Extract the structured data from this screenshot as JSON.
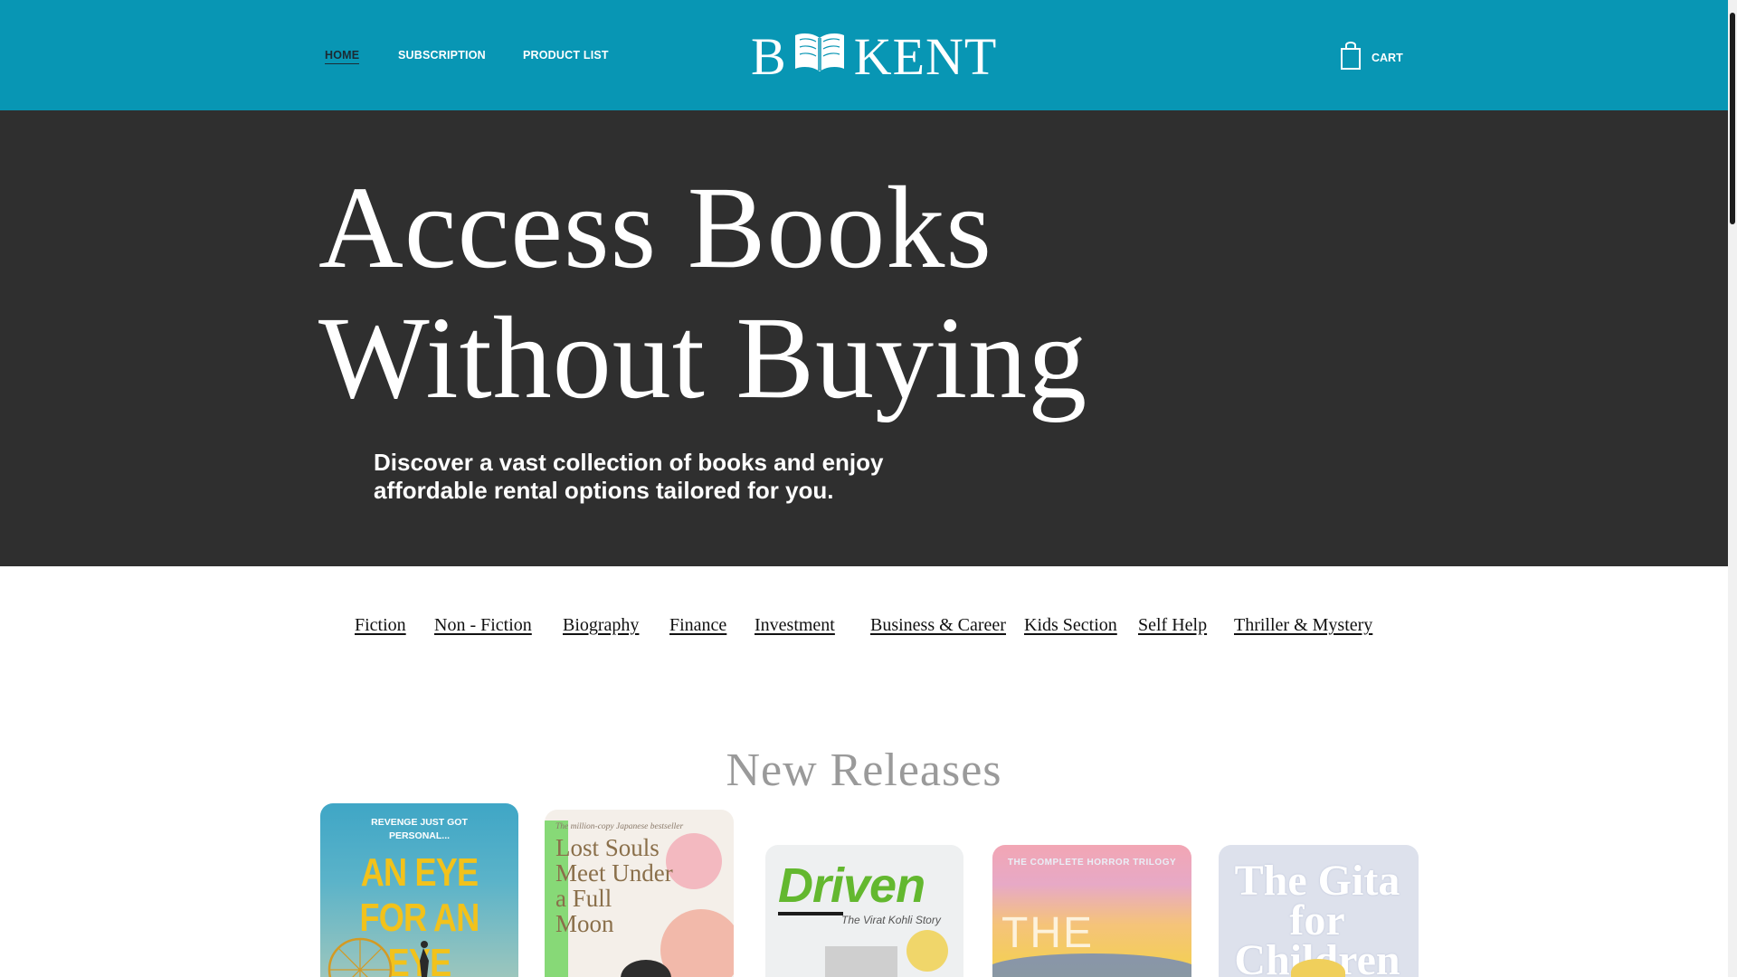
{
  "nav": {
    "home": "HOME",
    "subscription": "SUBSCRIPTION",
    "product_list": "PRODUCT LIST",
    "cart": "CART"
  },
  "logo": {
    "left": "B",
    "right": "KENT"
  },
  "hero": {
    "line1": "Access Books",
    "line2": "Without Buying",
    "subtitle": "Discover a vast collection of books and enjoy affordable rental options tailored for you."
  },
  "categories": [
    "Fiction",
    "Non - Fiction",
    "Biography",
    "Finance",
    "Investment",
    "Business & Career",
    "Kids Section",
    "Self Help",
    "Thriller & Mystery"
  ],
  "new_releases": {
    "title": "New Releases",
    "books": [
      {
        "tagline": "REVENGE JUST GOT PERSONAL...",
        "title": "AN EYE FOR AN EYE"
      },
      {
        "tagline": "The million-copy Japanese bestseller",
        "title": "Lost Souls Meet Under a Full Moon"
      },
      {
        "title": "Driven",
        "subtitle": "The Virat Kohli Story"
      },
      {
        "tagline": "THE COMPLETE HORROR TRILOGY",
        "title": "THE"
      },
      {
        "title": "The Gita for Children"
      }
    ]
  },
  "colors": {
    "header_bg": "#0896b4",
    "hero_bg": "#2f2f2f",
    "text_dark": "#111111"
  }
}
